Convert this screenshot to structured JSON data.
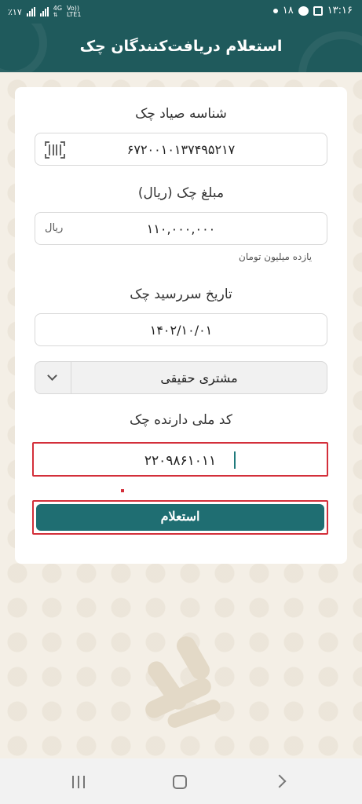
{
  "status_bar": {
    "left_text": "٪۱۷",
    "network": "4G",
    "network_sub": "LTE1",
    "volte": "Vo))",
    "notification_count": "۱۸",
    "time": "۱۳:۱۶"
  },
  "header": {
    "title": "استعلام دریافت‌کنندگان چک"
  },
  "form": {
    "sayad_label": "شناسه صیاد چک",
    "sayad_value": "۶۷۲۰۰۱۰۱۳۷۴۹۵۲۱۷",
    "sayad_icon": "barcode-scan-icon",
    "amount_label": "مبلغ چک (ریال)",
    "amount_value": "۱۱۰,۰۰۰,۰۰۰",
    "amount_unit": "ریال",
    "amount_words": "یازده میلیون تومان",
    "due_date_label": "تاریخ سررسید چک",
    "due_date_value": "۱۴۰۲/۱۰/۰۱",
    "customer_type_value": "مشتری حقیقی",
    "national_id_label": "کد ملی دارنده چک",
    "national_id_value": "۲۲۰۹۸۶۱۰۱۱",
    "submit_label": "استعلام"
  },
  "colors": {
    "header": "#1f5a5c",
    "button": "#1f6e72",
    "highlight": "#d32f3a",
    "background": "#f4efe6"
  },
  "nav": {
    "recent_icon": "recent-apps-icon",
    "home_icon": "home-icon",
    "back_icon": "back-icon"
  }
}
